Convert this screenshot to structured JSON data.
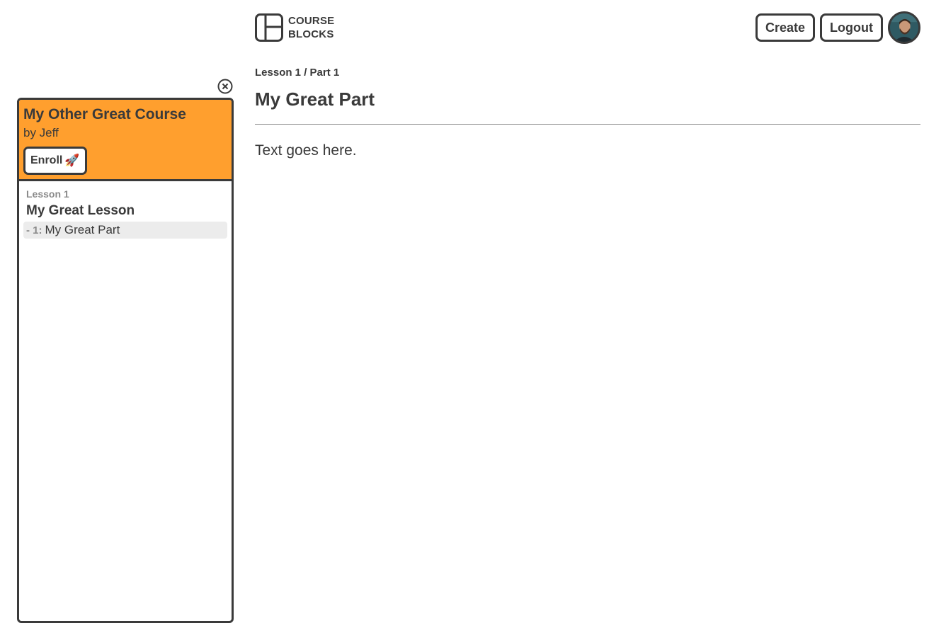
{
  "header": {
    "logo_line1": "COURSE",
    "logo_line2": "BLOCKS",
    "create_label": "Create",
    "logout_label": "Logout"
  },
  "sidebar": {
    "course_title": "My Other Great Course",
    "course_author": "by Jeff",
    "enroll_label": "Enroll",
    "enroll_icon": "🚀",
    "lessons": [
      {
        "label": "Lesson 1",
        "title": "My Great Lesson",
        "parts": [
          {
            "number": "- 1:",
            "title": "My Great Part"
          }
        ]
      }
    ]
  },
  "main": {
    "breadcrumb": "Lesson 1 / Part 1",
    "title": "My Great Part",
    "body": "Text goes here."
  },
  "colors": {
    "accent": "#ff9f2e",
    "text": "#3a3a3a",
    "muted": "#8a8a8a",
    "selected_bg": "#ececec"
  }
}
